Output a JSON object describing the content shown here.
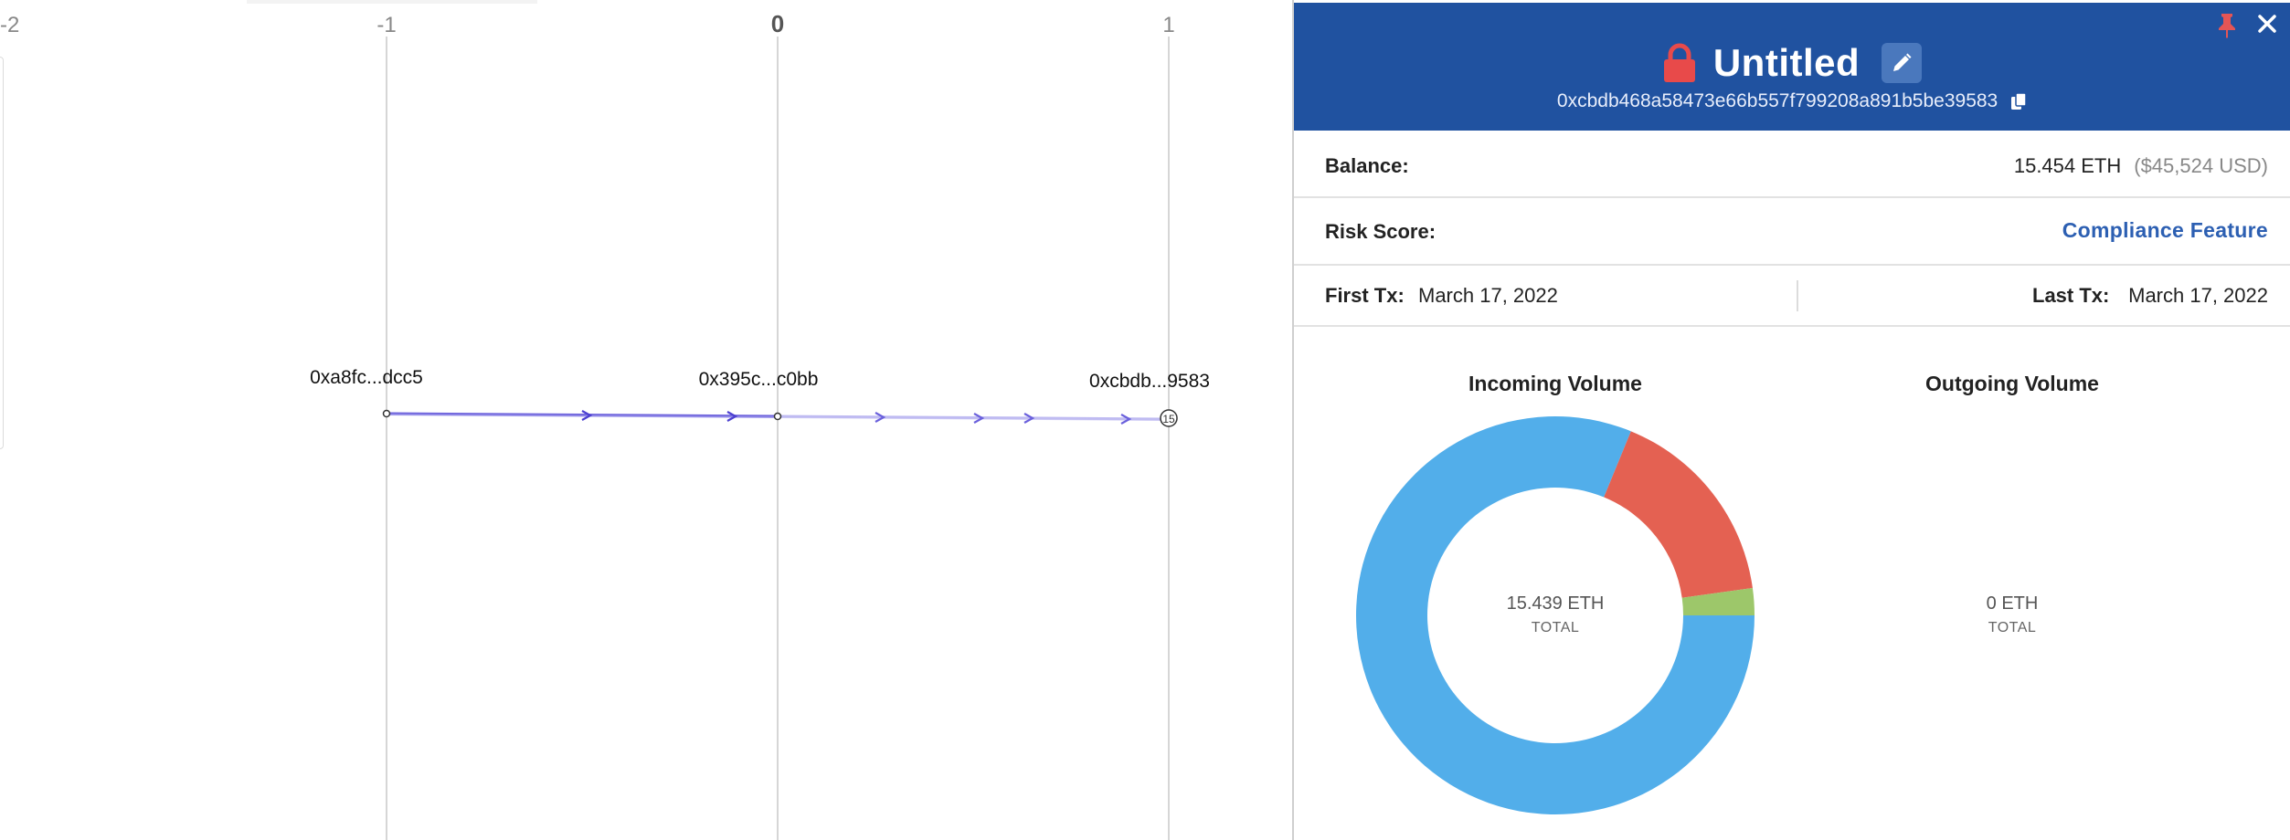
{
  "graph": {
    "axis_ticks": [
      "-2",
      "-1",
      "0",
      "1"
    ],
    "nodes": [
      {
        "label": "0xa8fc...dcc5"
      },
      {
        "label": "0x395c...c0bb"
      },
      {
        "label": "0xcbdb...9583",
        "badge": "15"
      }
    ],
    "edge_color": "#5b4fd8"
  },
  "panel": {
    "title": "Untitled",
    "address": "0xcbdb468a58473e66b557f799208a891b5be39583",
    "header_color": "#2052a0",
    "balance_label": "Balance:",
    "balance_eth": "15.454 ETH",
    "balance_usd": "($45,524 USD)",
    "risk_label": "Risk Score:",
    "risk_value": "Compliance Feature",
    "first_tx_label": "First Tx:",
    "first_tx_value": "March 17, 2022",
    "last_tx_label": "Last Tx:",
    "last_tx_value": "March 17, 2022",
    "incoming": {
      "title": "Incoming Volume",
      "total": "15.439 ETH",
      "total_label": "TOTAL",
      "slices": [
        {
          "share": 0.812,
          "color": "#52aeea"
        },
        {
          "share": 0.166,
          "color": "#e46152"
        },
        {
          "share": 0.022,
          "color": "#9dc76a"
        }
      ]
    },
    "outgoing": {
      "title": "Outgoing Volume",
      "total": "0 ETH",
      "total_label": "TOTAL"
    }
  }
}
